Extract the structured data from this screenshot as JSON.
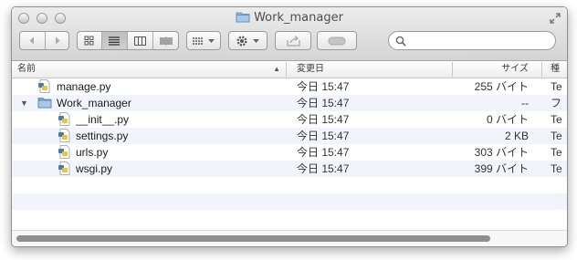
{
  "window": {
    "title": "Work_manager"
  },
  "icons": {
    "back": "chevron-left-icon",
    "forward": "chevron-right-icon",
    "views": [
      "icon-view-icon",
      "list-view-icon",
      "column-view-icon",
      "coverflow-icon"
    ],
    "arrange": "grid-arrange-icon",
    "action": "gear-icon",
    "share": "share-icon",
    "tags": "tag-icon",
    "search": "search-icon"
  },
  "search": {
    "placeholder": ""
  },
  "columns": {
    "name": "名前",
    "sort_indicator": "▲",
    "date": "変更日",
    "size": "サイズ",
    "kind": "種類"
  },
  "files": [
    {
      "name": "manage.py",
      "date": "今日 15:47",
      "size": "255 バイト",
      "kind": "Te",
      "type": "python",
      "indent": 0,
      "disclosure": ""
    },
    {
      "name": "Work_manager",
      "date": "今日 15:47",
      "size": "--",
      "kind": "フ",
      "type": "folder",
      "indent": 0,
      "disclosure": "▼"
    },
    {
      "name": "__init__.py",
      "date": "今日 15:47",
      "size": "0 バイト",
      "kind": "Te",
      "type": "python",
      "indent": 1,
      "disclosure": ""
    },
    {
      "name": "settings.py",
      "date": "今日 15:47",
      "size": "2 KB",
      "kind": "Te",
      "type": "python",
      "indent": 1,
      "disclosure": ""
    },
    {
      "name": "urls.py",
      "date": "今日 15:47",
      "size": "303 バイト",
      "kind": "Te",
      "type": "python",
      "indent": 1,
      "disclosure": ""
    },
    {
      "name": "wsgi.py",
      "date": "今日 15:47",
      "size": "399 バイト",
      "kind": "Te",
      "type": "python",
      "indent": 1,
      "disclosure": ""
    }
  ]
}
